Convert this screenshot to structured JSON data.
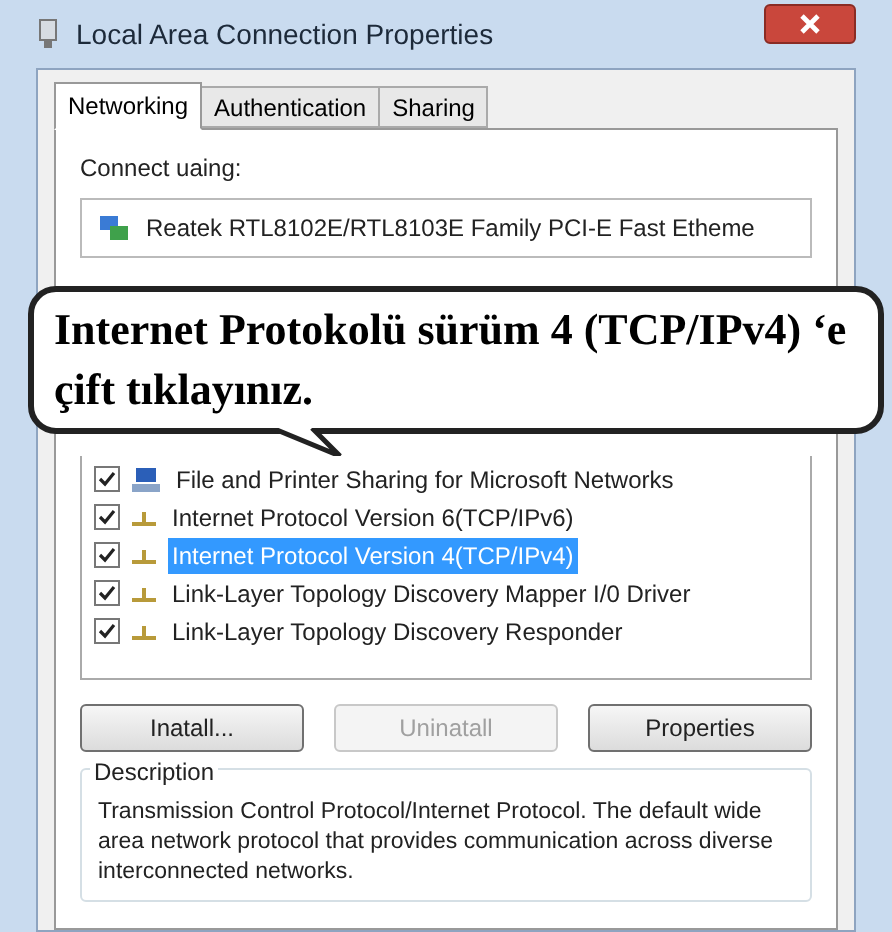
{
  "window": {
    "title": "Local Area Connection Properties"
  },
  "tabs": [
    {
      "label": "Networking",
      "selected": true
    },
    {
      "label": "Authentication",
      "selected": false
    },
    {
      "label": "Sharing",
      "selected": false
    }
  ],
  "connect_using": {
    "label": "Connect uaing:",
    "adapter": "Reatek RTL8102E/RTL8103E Family PCI-E Fast Etheme"
  },
  "callout": {
    "text": "Internet Protokolü sürüm 4 (TCP/IPv4) ‘e çift tıklayınız."
  },
  "items": [
    {
      "kind": "service",
      "label": "File and Printer Sharing for Microsoft Networks",
      "checked": true,
      "selected": false
    },
    {
      "kind": "protocol",
      "label": "Internet Protocol Version 6(TCP/IPv6)",
      "checked": true,
      "selected": false
    },
    {
      "kind": "protocol",
      "label": "Internet Protocol Version 4(TCP/IPv4)",
      "checked": true,
      "selected": true
    },
    {
      "kind": "protocol",
      "label": "Link-Layer Topology Discovery Mapper I/0 Driver",
      "checked": true,
      "selected": false
    },
    {
      "kind": "protocol",
      "label": "Link-Layer Topology Discovery Responder",
      "checked": true,
      "selected": false
    }
  ],
  "buttons": [
    {
      "label": "Inatall...",
      "disabled": false
    },
    {
      "label": "Uninatall",
      "disabled": true
    },
    {
      "label": "Properties",
      "disabled": false
    }
  ],
  "description": {
    "title": "Description",
    "text": "Transmission Control Protocol/Internet Protocol. The default wide area network protocol that provides communication across diverse interconnected networks."
  }
}
